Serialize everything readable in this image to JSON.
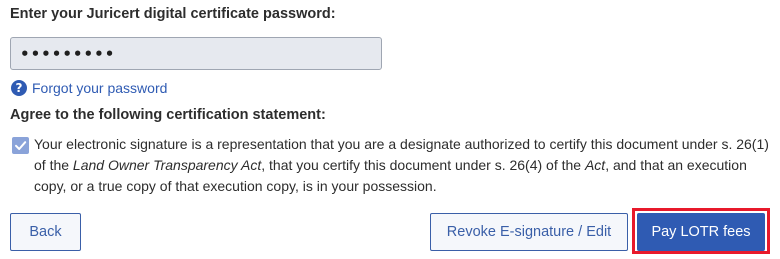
{
  "password_section": {
    "label": "Enter your Juricert digital certificate password:",
    "masked_value": "•••••••••",
    "forgot_link": "Forgot your password"
  },
  "certification": {
    "heading": "Agree to the following certification statement:",
    "checked": true,
    "statement_part1": "Your electronic signature is a representation that you are a designate authorized to certify this document under s. 26(1) of the ",
    "statement_act_name": "Land Owner Transparency Act",
    "statement_part2": ", that you certify this document under s. 26(4) of the ",
    "statement_act_short": "Act",
    "statement_part3": ", and that an execution copy, or a true copy of that execution copy, is in your possession."
  },
  "actions": {
    "back_label": "Back",
    "revoke_label": "Revoke E-signature / Edit",
    "pay_label": "Pay LOTR fees"
  },
  "colors": {
    "primary": "#2f5bb3",
    "highlight": "#e8192b",
    "checkbox": "#8aa3d9"
  },
  "icons": {
    "help": "question-circle-icon",
    "check": "checkmark-icon"
  }
}
